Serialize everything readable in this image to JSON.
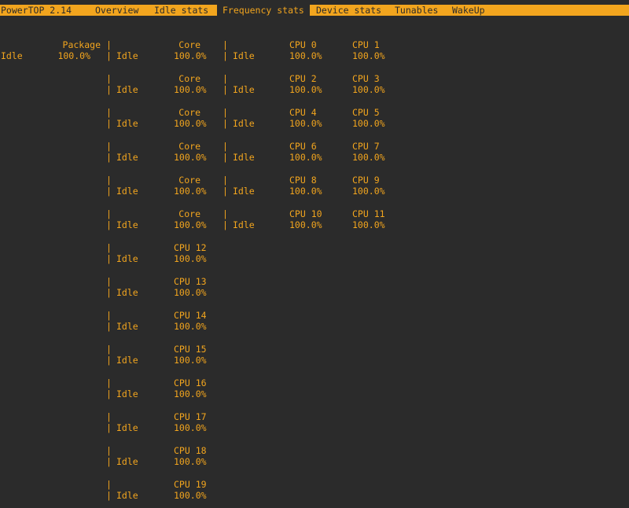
{
  "menu": {
    "title": "PowerTOP 2.14",
    "tabs": [
      {
        "label": "Overview"
      },
      {
        "label": "Idle stats"
      },
      {
        "label": "Frequency stats",
        "active": true
      },
      {
        "label": "Device stats"
      },
      {
        "label": "Tunables"
      },
      {
        "label": "WakeUp"
      }
    ]
  },
  "separator": "|",
  "package": {
    "header": "Package",
    "label": "Idle",
    "value": "100.0%"
  },
  "cores": [
    {
      "header": "Core",
      "label": "Idle",
      "value": "100.0%"
    },
    {
      "header": "Core",
      "label": "Idle",
      "value": "100.0%"
    },
    {
      "header": "Core",
      "label": "Idle",
      "value": "100.0%"
    },
    {
      "header": "Core",
      "label": "Idle",
      "value": "100.0%"
    },
    {
      "header": "Core",
      "label": "Idle",
      "value": "100.0%"
    },
    {
      "header": "Core",
      "label": "Idle",
      "value": "100.0%"
    },
    {
      "header": "CPU 12",
      "label": "Idle",
      "value": "100.0%"
    },
    {
      "header": "CPU 13",
      "label": "Idle",
      "value": "100.0%"
    },
    {
      "header": "CPU 14",
      "label": "Idle",
      "value": "100.0%"
    },
    {
      "header": "CPU 15",
      "label": "Idle",
      "value": "100.0%"
    },
    {
      "header": "CPU 16",
      "label": "Idle",
      "value": "100.0%"
    },
    {
      "header": "CPU 17",
      "label": "Idle",
      "value": "100.0%"
    },
    {
      "header": "CPU 18",
      "label": "Idle",
      "value": "100.0%"
    },
    {
      "header": "CPU 19",
      "label": "Idle",
      "value": "100.0%"
    }
  ],
  "cpu_pairs": [
    {
      "label": "Idle",
      "a": {
        "header": "CPU 0",
        "value": "100.0%"
      },
      "b": {
        "header": "CPU 1",
        "value": "100.0%"
      }
    },
    {
      "label": "Idle",
      "a": {
        "header": "CPU 2",
        "value": "100.0%"
      },
      "b": {
        "header": "CPU 3",
        "value": "100.0%"
      }
    },
    {
      "label": "Idle",
      "a": {
        "header": "CPU 4",
        "value": "100.0%"
      },
      "b": {
        "header": "CPU 5",
        "value": "100.0%"
      }
    },
    {
      "label": "Idle",
      "a": {
        "header": "CPU 6",
        "value": "100.0%"
      },
      "b": {
        "header": "CPU 7",
        "value": "100.0%"
      }
    },
    {
      "label": "Idle",
      "a": {
        "header": "CPU 8",
        "value": "100.0%"
      },
      "b": {
        "header": "CPU 9",
        "value": "100.0%"
      }
    },
    {
      "label": "Idle",
      "a": {
        "header": "CPU 10",
        "value": "100.0%"
      },
      "b": {
        "header": "CPU 11",
        "value": "100.0%"
      }
    }
  ],
  "colors": {
    "background": "#2b2b2b",
    "accent": "#f2a51e"
  }
}
